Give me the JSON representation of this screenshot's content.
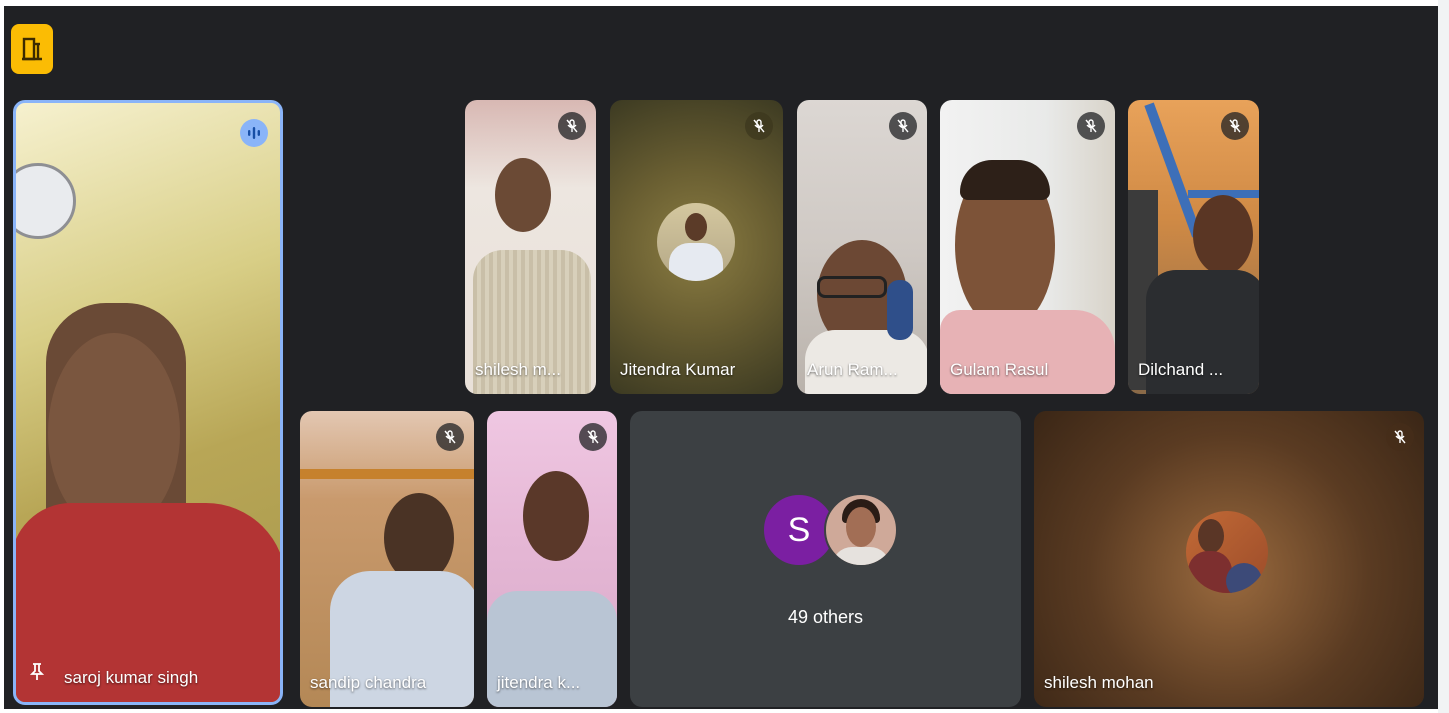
{
  "app": {
    "icon": "door-exit-icon",
    "accent": "#fbbc04"
  },
  "stage": {
    "background": "#202124"
  },
  "tiles": {
    "saroj": {
      "name": "saroj kumar singh",
      "status": "speaking-icon",
      "pin_icon": "pin-icon"
    },
    "shilesh_m": {
      "name": "shilesh m...",
      "status": "mic-off-icon"
    },
    "jitendra_kumar": {
      "name": "Jitendra Kumar",
      "status": "mic-off-icon"
    },
    "arun": {
      "name": "Arun Ram...",
      "status": "mic-off-icon"
    },
    "gulam": {
      "name": "Gulam Rasul",
      "status": "mic-off-icon"
    },
    "dilchand": {
      "name": "Dilchand ...",
      "status": "mic-off-icon"
    },
    "sandip": {
      "name": "sandip chandra",
      "status": "mic-off-icon"
    },
    "jitendra_k": {
      "name": "jitendra k...",
      "status": "mic-off-icon"
    },
    "others": {
      "initial": "S",
      "label": "49 others",
      "initial_color": "#7b1fa2"
    },
    "shilesh_mohan": {
      "name": "shilesh mohan",
      "status": "mic-off-icon"
    }
  }
}
